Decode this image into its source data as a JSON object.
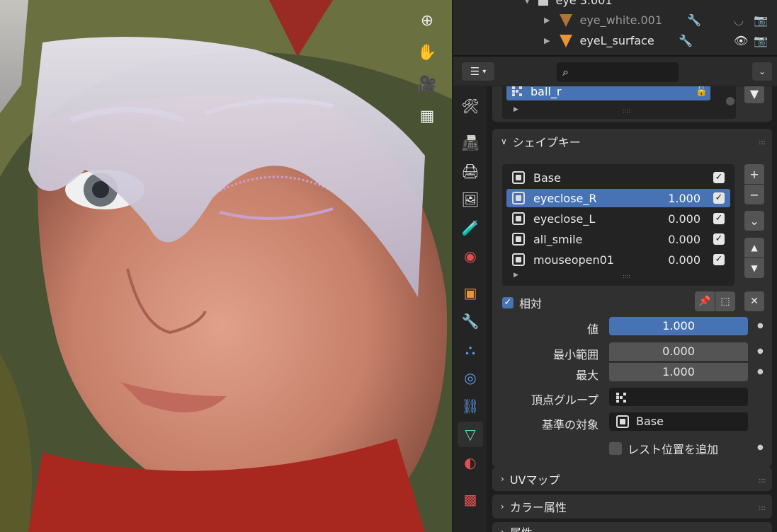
{
  "viewport": {
    "tools": [
      {
        "name": "zoom-icon",
        "glyph": "⊕"
      },
      {
        "name": "hand-pan-icon",
        "glyph": "✋"
      },
      {
        "name": "camera-icon",
        "glyph": "🎥"
      },
      {
        "name": "grid-perspective-icon",
        "glyph": "▦"
      }
    ]
  },
  "outliner": {
    "rows": [
      {
        "label": "eye 3.001"
      },
      {
        "label": "eye_white.001"
      },
      {
        "label": "eyeL_surface"
      }
    ]
  },
  "header": {
    "search_placeholder": "",
    "editor_icon": "☰"
  },
  "vertex_groups": {
    "selected_label": "ball_r"
  },
  "shape_keys": {
    "title": "シェイプキー",
    "items": [
      {
        "label": "Base",
        "value": ""
      },
      {
        "label": "eyeclose_R",
        "value": "1.000"
      },
      {
        "label": "eyeclose_L",
        "value": "0.000"
      },
      {
        "label": "all_smile",
        "value": "0.000"
      },
      {
        "label": "mouseopen01",
        "value": "0.000"
      }
    ],
    "relative_label": "相対",
    "fields": {
      "value_label": "値",
      "value": "1.000",
      "min_label": "最小範囲",
      "min": "0.000",
      "max_label": "最大",
      "max": "1.000",
      "vgroup_label": "頂点グループ",
      "vgroup": "",
      "relative_to_label": "基準の対象",
      "relative_to": "Base",
      "rest_label": "レスト位置を追加"
    }
  },
  "collapsed_panels": {
    "uv": "UVマップ",
    "color": "カラー属性",
    "attr": "属性"
  },
  "colors": {
    "accent": "#4772b3",
    "panel": "#303030",
    "background": "#1e1e1e"
  }
}
